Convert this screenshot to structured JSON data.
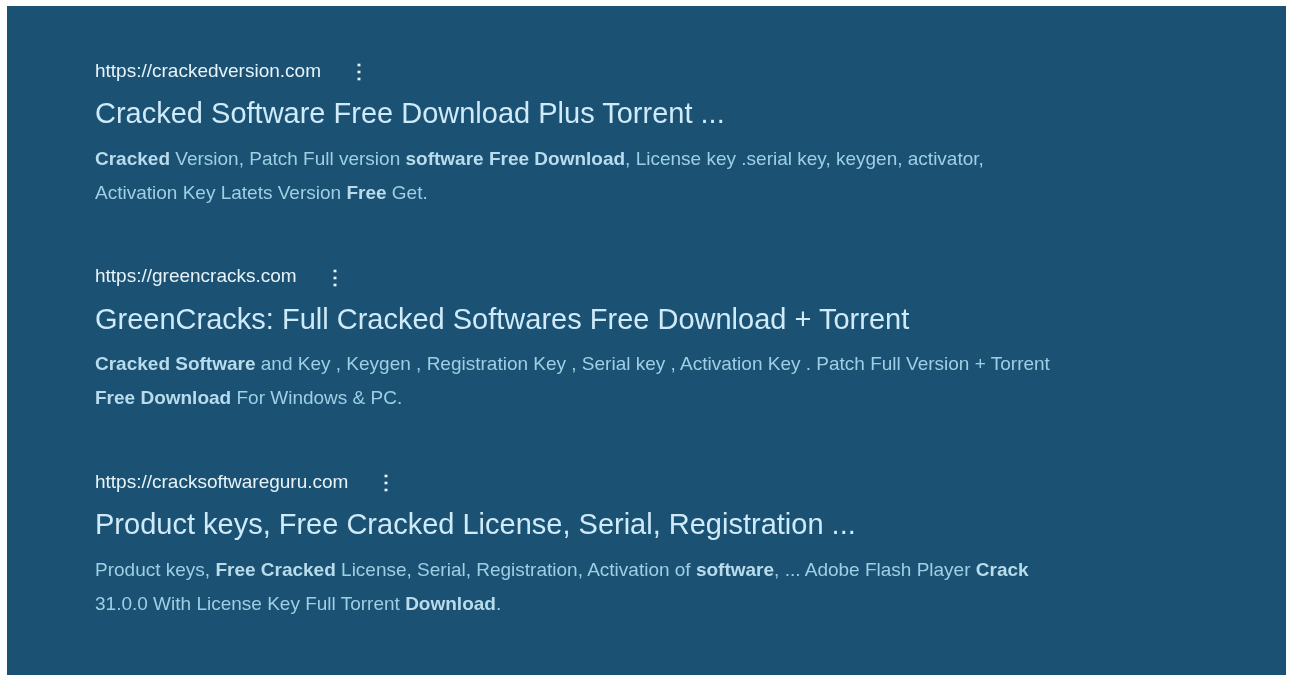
{
  "results": [
    {
      "url": "https://crackedversion.com",
      "menu": "⋮",
      "title": "Cracked Software Free Download Plus Torrent ...",
      "snippet": "**Cracked** Version, Patch Full version **software Free Download**, License key .serial key, keygen, activator, Activation Key Latets Version **Free** Get."
    },
    {
      "url": "https://greencracks.com",
      "menu": "⋮",
      "title": "GreenCracks: Full Cracked Softwares Free Download + Torrent",
      "snippet": "**Cracked Software** and Key , Keygen , Registration Key , Serial key , Activation Key . Patch Full Version + Torrent **Free Download** For Windows & PC."
    },
    {
      "url": "https://cracksoftwareguru.com",
      "menu": "⋮",
      "title": "Product keys, Free Cracked License, Serial, Registration ...",
      "snippet": "Product keys, **Free Cracked** License, Serial, Registration, Activation of **software**, ... Adobe Flash Player **Crack** 31.0.0 With License Key Full Torrent **Download**."
    }
  ]
}
